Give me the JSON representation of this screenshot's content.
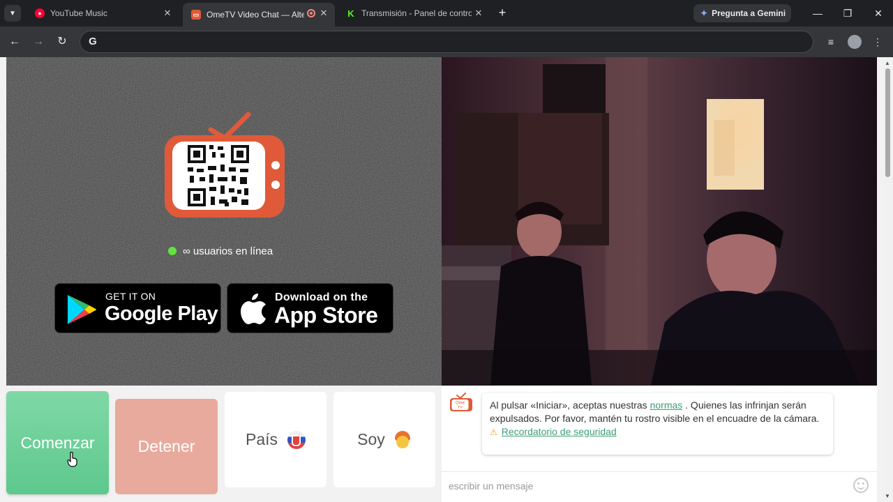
{
  "browser": {
    "tabs": [
      {
        "title": "YouTube Music",
        "favicon": "youtube-music-icon",
        "active": false
      },
      {
        "title": "OmeTV Video Chat — Alter",
        "favicon": "ometv-icon",
        "active": true,
        "recording": true
      },
      {
        "title": "Transmisión - Panel de control",
        "favicon": "kick-icon",
        "active": false
      }
    ],
    "gemini_label": "Pregunta a Gemini",
    "address_value": ""
  },
  "page": {
    "online_text": "∞ usuarios en línea",
    "google_play": {
      "small": "GET IT ON",
      "big": "Google Play"
    },
    "app_store": {
      "small": "Download on the",
      "big": "App Store"
    }
  },
  "controls": {
    "start_label": "Comenzar",
    "stop_label": "Detener",
    "country_label": "País",
    "gender_label": "Soy"
  },
  "chat": {
    "notice_before": "Al pulsar «Iniciar», aceptas nuestras",
    "notice_link": "normas",
    "notice_after": ". Quienes las infrinjan serán expulsados. Por favor, mantén tu rostro visible en el encuadre de la cámara.",
    "safety_link": "Recordatorio de seguridad",
    "input_placeholder": "escribir un mensaje"
  },
  "colors": {
    "start": "#6fd19b",
    "stop": "#e8aa9d",
    "brand_tv": "#e05a3a",
    "online_dot": "#61e33b",
    "link": "#3f9e74"
  }
}
